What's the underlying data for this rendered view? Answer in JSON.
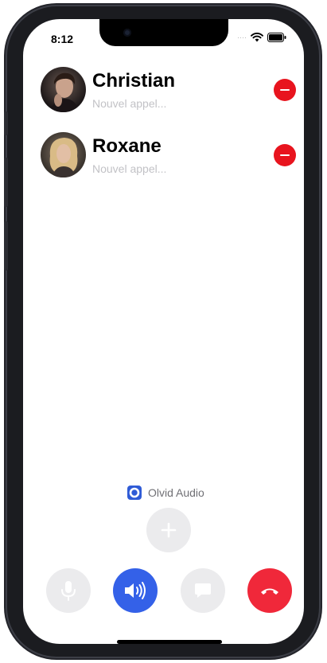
{
  "status_bar": {
    "time": "8:12"
  },
  "calls": [
    {
      "name": "Christian",
      "status": "Nouvel appel..."
    },
    {
      "name": "Roxane",
      "status": "Nouvel appel..."
    }
  ],
  "audio": {
    "output_label": "Olvid Audio"
  },
  "colors": {
    "end_call": "#f0283a",
    "speaker_active": "#3461e8",
    "remove": "#e8141e",
    "inactive_button": "#ebebed",
    "secondary_text": "#c2c2c6"
  },
  "icons": {
    "mute": "microphone-icon",
    "speaker": "speaker-icon",
    "chat": "chat-bubble-icon",
    "end": "phone-hangup-icon",
    "add": "plus-icon",
    "remove": "minus-icon",
    "audio_output": "olvid-logo-icon"
  }
}
